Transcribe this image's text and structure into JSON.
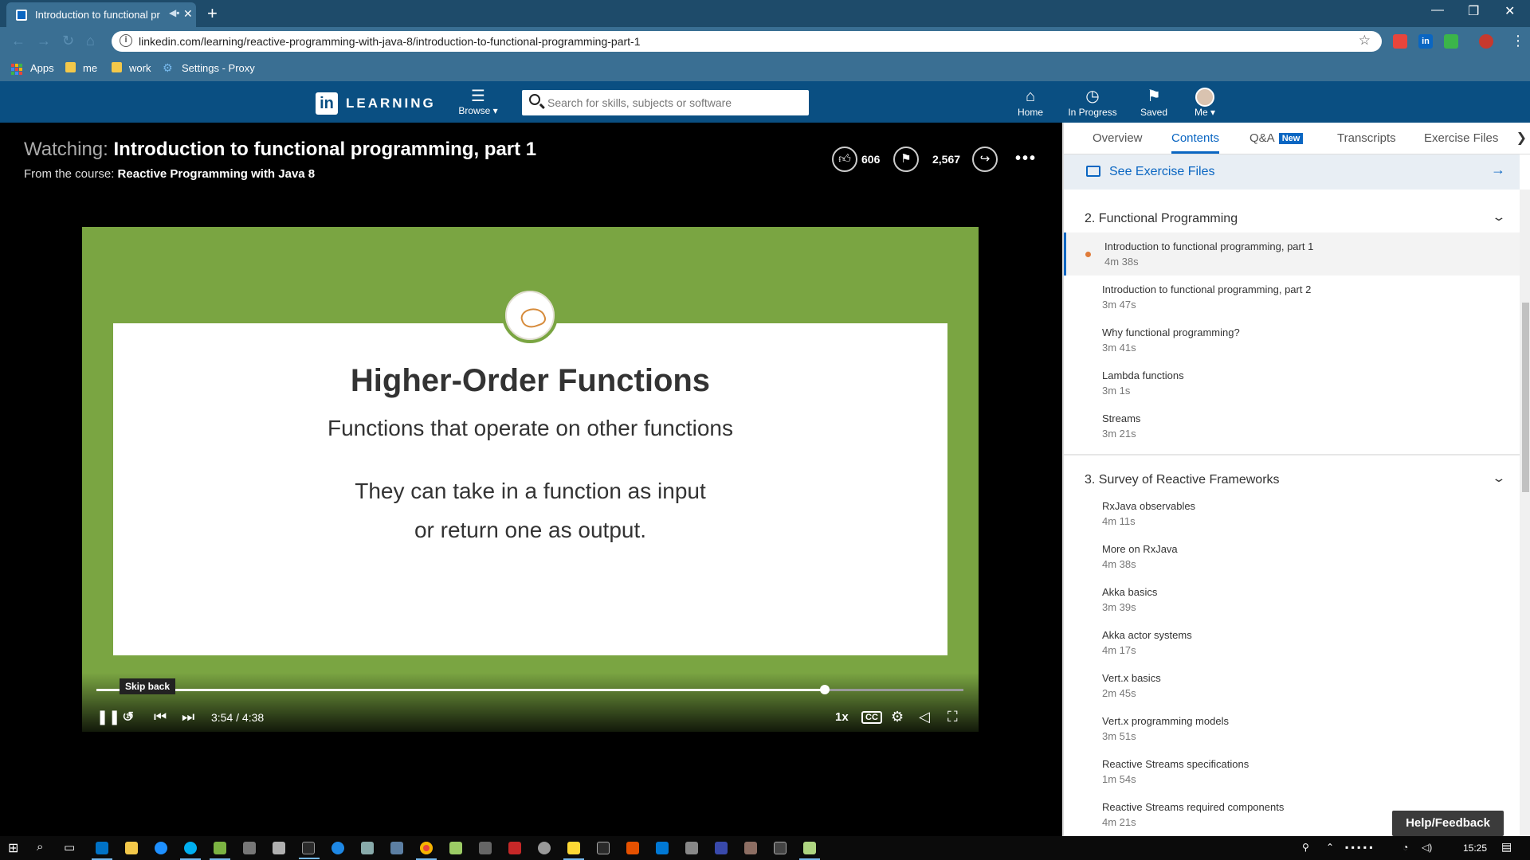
{
  "browser": {
    "tab_title": "Introduction to functional pr",
    "url": "linkedin.com/learning/reactive-programming-with-java-8/introduction-to-functional-programming-part-1",
    "bookmarks": [
      "Apps",
      "me",
      "work",
      "Settings - Proxy"
    ],
    "badge_count": "6"
  },
  "header": {
    "logo_text": "in",
    "brand": "LEARNING",
    "browse_label": "Browse ▾",
    "search_placeholder": "Search for skills, subjects or software",
    "nav": [
      "Home",
      "In Progress",
      "Saved",
      "Me ▾"
    ]
  },
  "player": {
    "watching_prefix": "Watching:",
    "watching_title": "Introduction to functional programming, part 1",
    "from_prefix": "From the course:",
    "course": "Reactive Programming with Java 8",
    "likes": "606",
    "saves": "2,567",
    "progress": 0.84,
    "time": "3:54 / 4:38",
    "speed": "1x",
    "tooltip": "Skip back",
    "skip_seconds": "10"
  },
  "slide": {
    "title": "Higher-Order Functions",
    "subtitle": "Functions that operate on other functions",
    "body_line1": "They can take in a function as input",
    "body_line2": "or return one as output."
  },
  "panel": {
    "tabs": [
      "Overview",
      "Contents",
      "Q&A",
      "Transcripts",
      "Exercise Files"
    ],
    "new_badge": "New",
    "exercise_files": "See Exercise Files",
    "sections": [
      {
        "title": "2. Functional Programming",
        "items": [
          {
            "name": "Introduction to functional programming, part 1",
            "duration": "4m 38s"
          },
          {
            "name": "Introduction to functional programming, part 2",
            "duration": "3m 47s"
          },
          {
            "name": "Why functional programming?",
            "duration": "3m 41s"
          },
          {
            "name": "Lambda functions",
            "duration": "3m 1s"
          },
          {
            "name": "Streams",
            "duration": "3m 21s"
          }
        ]
      },
      {
        "title": "3. Survey of Reactive Frameworks",
        "items": [
          {
            "name": "RxJava observables",
            "duration": "4m 11s"
          },
          {
            "name": "More on RxJava",
            "duration": "4m 38s"
          },
          {
            "name": "Akka basics",
            "duration": "3m 39s"
          },
          {
            "name": "Akka actor systems",
            "duration": "4m 17s"
          },
          {
            "name": "Vert.x basics",
            "duration": "2m 45s"
          },
          {
            "name": "Vert.x programming models",
            "duration": "3m 51s"
          },
          {
            "name": "Reactive Streams specifications",
            "duration": "1m 54s"
          },
          {
            "name": "Reactive Streams required components",
            "duration": "4m 21s"
          }
        ]
      }
    ],
    "help_feedback": "Help/Feedback"
  },
  "taskbar": {
    "clock": "15:25"
  },
  "colors": {
    "linkedin_blue": "#0a4f82",
    "accent": "#0a66c2",
    "slide_green": "#7aa542",
    "current_dot": "#e07b39"
  }
}
